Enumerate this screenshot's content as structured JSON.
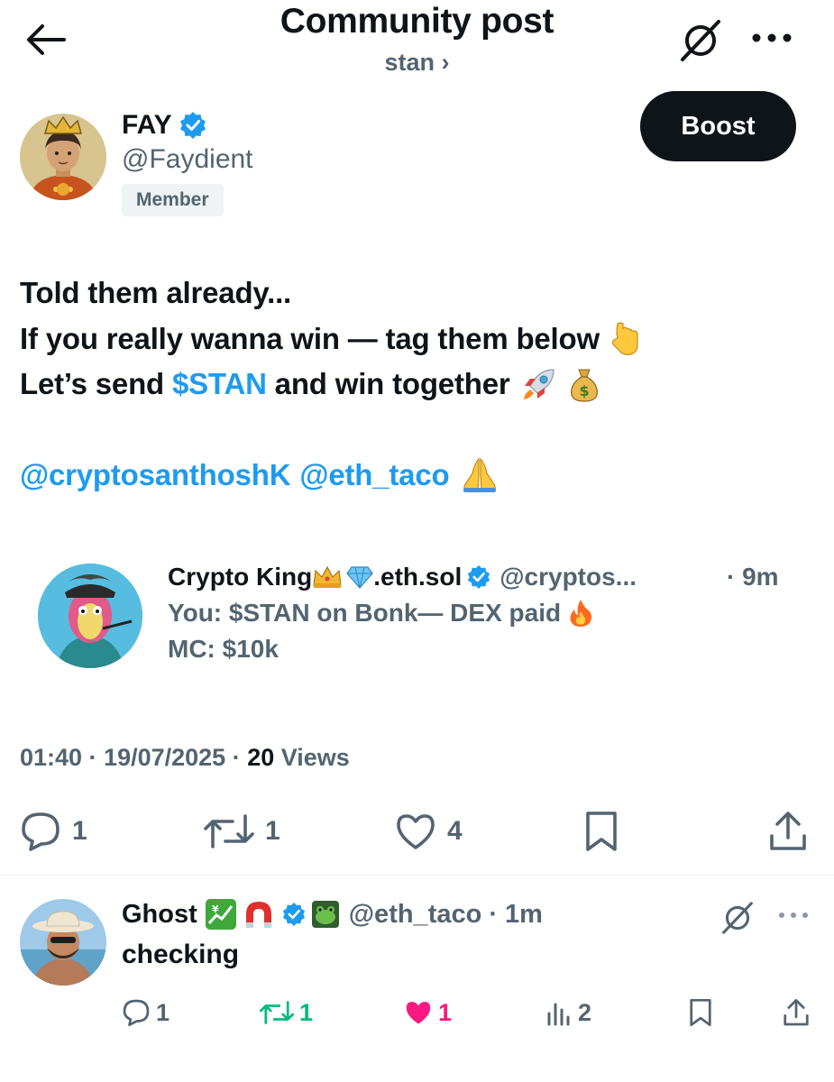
{
  "header": {
    "title": "Community post",
    "community_link": "stan ›"
  },
  "post": {
    "author_name": "FAY",
    "author_handle": "@Faydient",
    "member_badge": "Member",
    "boost_label": "Boost",
    "lines": {
      "line1": "Told them already...",
      "line2": "If you really wanna win — tag them below",
      "line3_pre": "Let’s send ",
      "line3_cashtag": "$STAN",
      "line3_post": " and win together",
      "mention1": "@cryptosanthoshK",
      "mention2": "@eth_taco"
    },
    "embed": {
      "name": "Crypto King",
      "name_suffix": ".eth.sol",
      "handle": "@cryptos...",
      "time": "· 9m",
      "line2": "You: $STAN on Bonk— DEX paid",
      "line3": "MC: $10k"
    },
    "meta": {
      "timestamp": "01:40 · 19/07/2025 · ",
      "views_count": "20",
      "views_label": " Views"
    },
    "actions": {
      "replies": "1",
      "reposts": "1",
      "likes": "4"
    }
  },
  "reply": {
    "author_name": "Ghost",
    "handle": "@eth_taco",
    "time": "· 1m",
    "text": "checking",
    "actions": {
      "replies": "1",
      "reposts": "1",
      "likes": "1",
      "views": "2"
    }
  },
  "colors": {
    "accent_blue": "#1d9bf0",
    "text_primary": "#0f1419",
    "text_secondary": "#536471",
    "repost_green": "#00ba7c",
    "like_pink": "#f91880"
  }
}
